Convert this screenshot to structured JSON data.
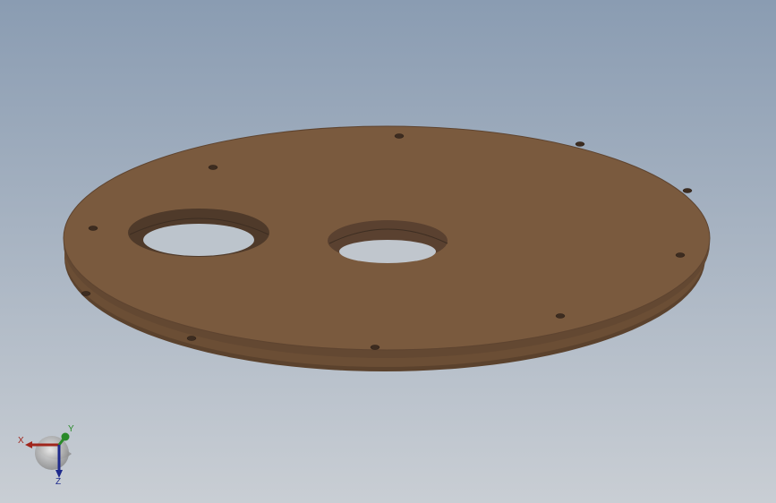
{
  "viewport": {
    "background_top": "#8a9cb2",
    "background_bottom": "#c9ced4"
  },
  "part": {
    "face_color": "#7a5a3e",
    "edge_color": "#5e4430",
    "side_color": "#6a4d33",
    "hole_wall_color": "#5a4130",
    "mounting_holes": 12,
    "large_holes": 2
  },
  "triad": {
    "x_label": "X",
    "y_label": "Y",
    "z_label": "Z",
    "x_color": "#a0261c",
    "y_color": "#2a8a2a",
    "z_color": "#1e2a8c"
  }
}
